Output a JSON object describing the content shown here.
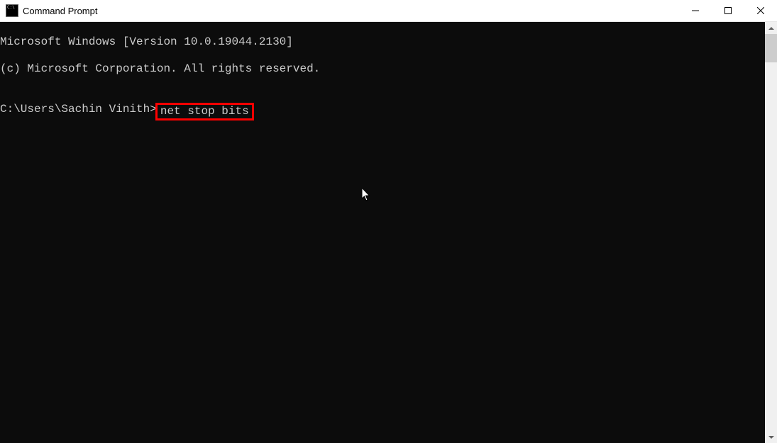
{
  "window": {
    "title": "Command Prompt"
  },
  "terminal": {
    "line1": "Microsoft Windows [Version 10.0.19044.2130]",
    "line2": "(c) Microsoft Corporation. All rights reserved.",
    "blank": "",
    "prompt": "C:\\Users\\Sachin Vinith>",
    "command": "net stop bits"
  }
}
